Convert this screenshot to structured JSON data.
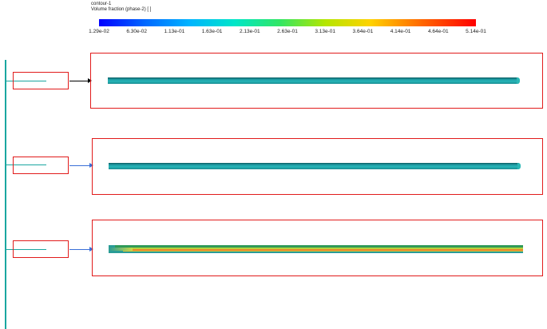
{
  "legend": {
    "title": "contour-1",
    "subtitle": "Volume fraction (phase-2)  [ ]",
    "colors": [
      "#0000ff",
      "#00b4ff",
      "#32e664",
      "#ffd200",
      "#ff0000"
    ],
    "ticks": [
      "1.29e-02",
      "6.30e-02",
      "1.13e-01",
      "1.63e-01",
      "2.13e-01",
      "2.63e-01",
      "3.13e-01",
      "3.64e-01",
      "4.14e-01",
      "4.64e-01",
      "5.14e-01"
    ]
  },
  "panels": [
    {
      "arrow_color": "#000000",
      "fill": "uniform"
    },
    {
      "arrow_color": "#3a6fd8",
      "fill": "uniform"
    },
    {
      "arrow_color": "#3a6fd8",
      "fill": "stratified"
    }
  ],
  "colors": {
    "box_border": "#e11b1b",
    "trunk": "#1aa6a0"
  }
}
